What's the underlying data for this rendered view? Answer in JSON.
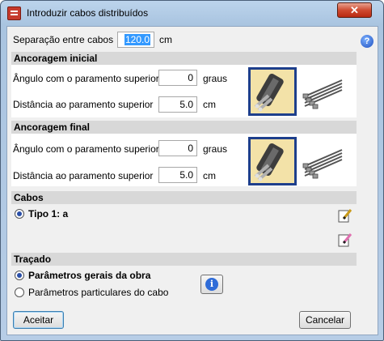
{
  "window": {
    "title": "Introduzir cabos distribuídos",
    "close_glyph": "✕"
  },
  "separation": {
    "label": "Separação entre cabos",
    "value": "120.0",
    "unit": "cm"
  },
  "help_glyph": "?",
  "anc_initial": {
    "title": "Ancoragem inicial",
    "angle_label": "Ângulo com o paramento superior",
    "angle_value": "0",
    "angle_unit": "graus",
    "dist_label": "Distância ao paramento superior",
    "dist_value": "5.0",
    "dist_unit": "cm"
  },
  "anc_final": {
    "title": "Ancoragem final",
    "angle_label": "Ângulo com o paramento superior",
    "angle_value": "0",
    "angle_unit": "graus",
    "dist_label": "Distância ao paramento superior",
    "dist_value": "5.0",
    "dist_unit": "cm"
  },
  "cables": {
    "title": "Cabos",
    "items": [
      {
        "label": "Tipo 1: a",
        "selected": true
      }
    ]
  },
  "tracado": {
    "title": "Traçado",
    "options": [
      {
        "label": "Parâmetros gerais da obra",
        "selected": true
      },
      {
        "label": "Parâmetros particulares do cabo",
        "selected": false
      }
    ],
    "info_glyph": "i"
  },
  "buttons": {
    "accept": "Aceitar",
    "cancel": "Cancelar"
  }
}
